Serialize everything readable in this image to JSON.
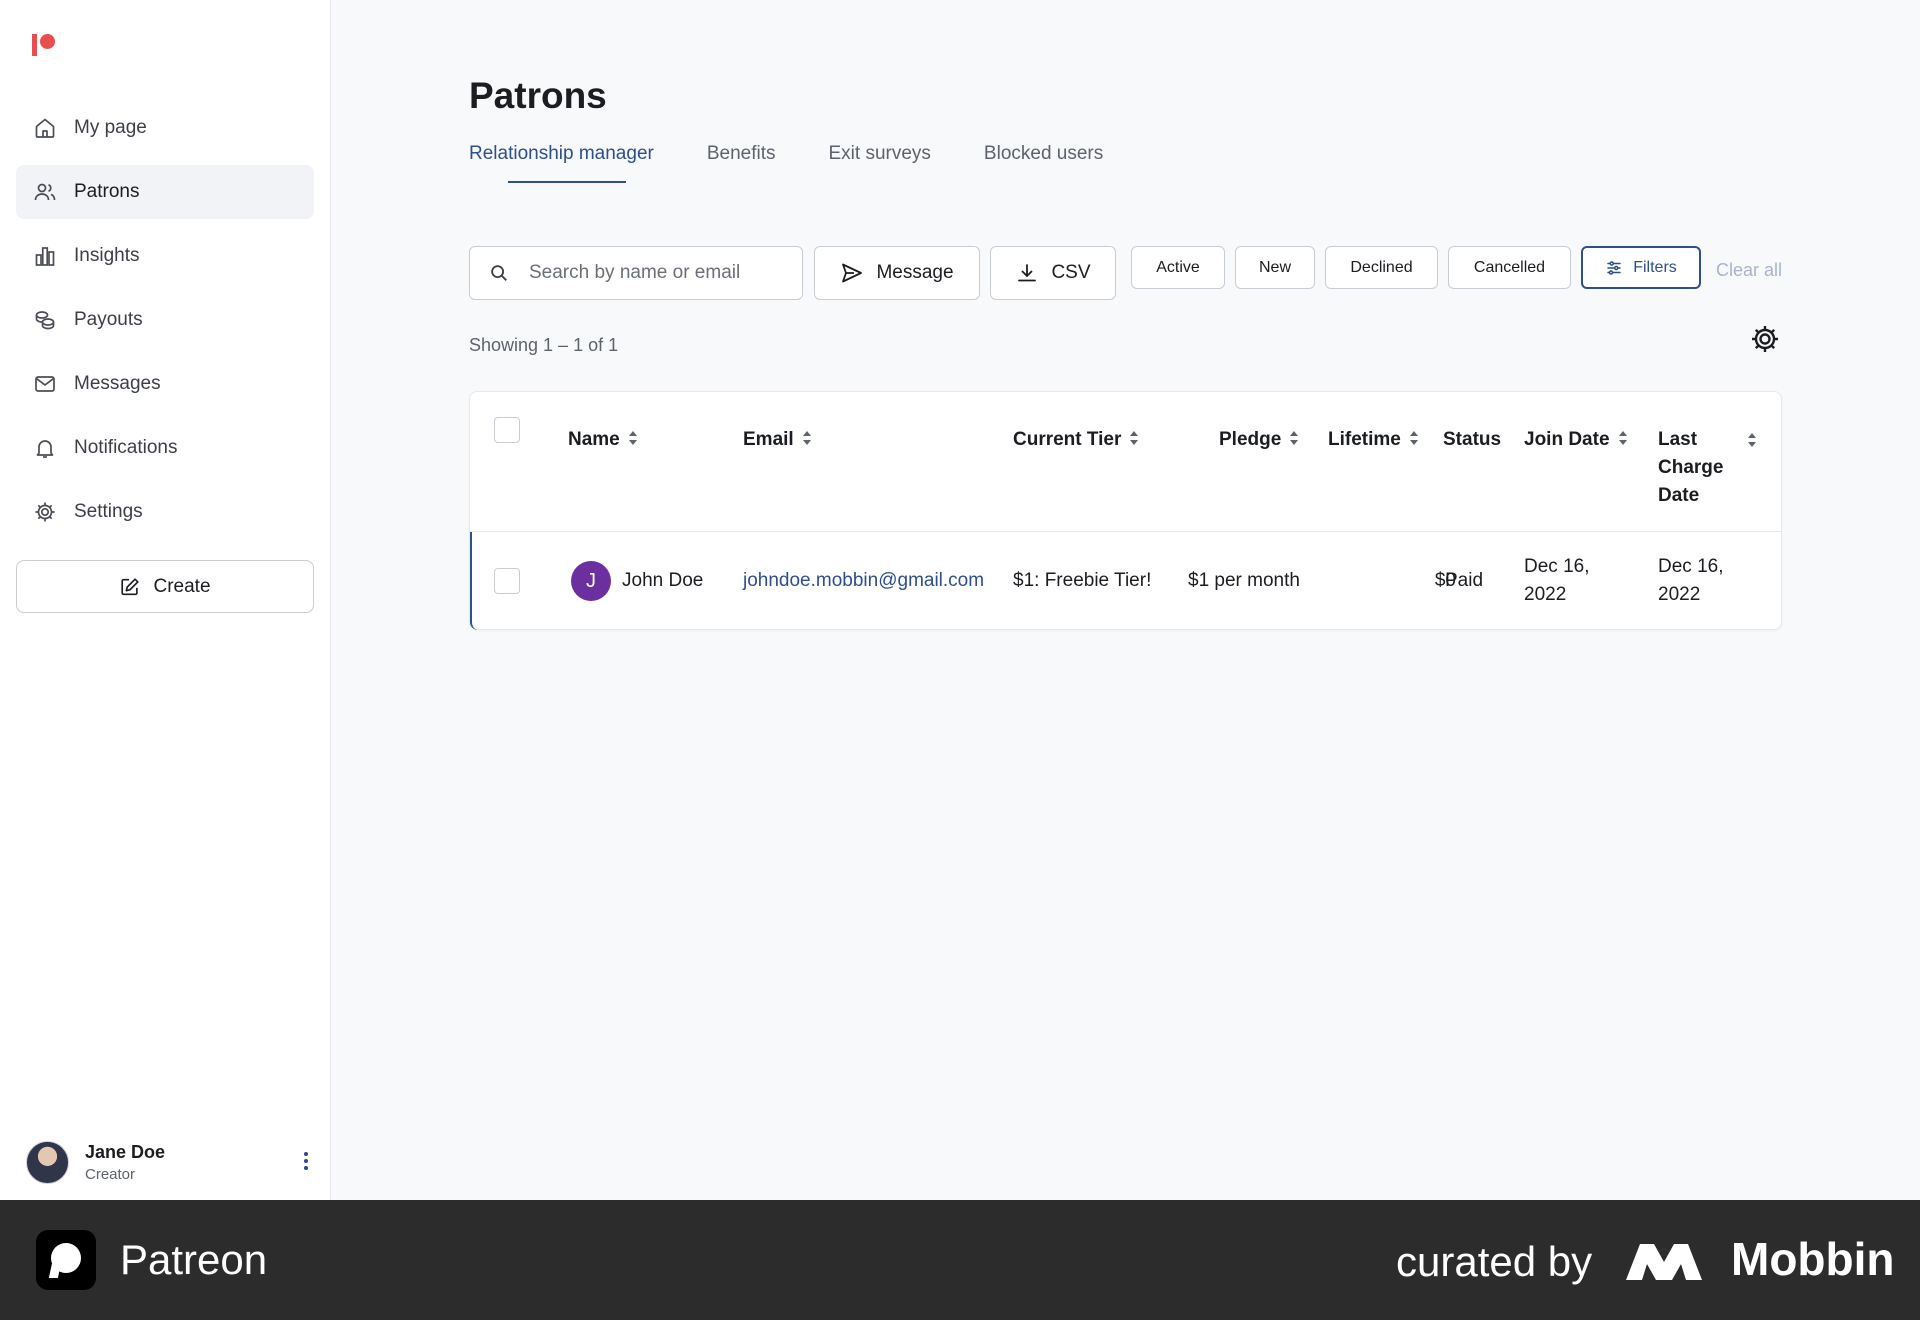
{
  "sidebar": {
    "items": [
      {
        "label": "My page",
        "icon": "home-icon"
      },
      {
        "label": "Patrons",
        "icon": "users-icon",
        "active": true
      },
      {
        "label": "Insights",
        "icon": "bar-chart-icon"
      },
      {
        "label": "Payouts",
        "icon": "coins-icon"
      },
      {
        "label": "Messages",
        "icon": "mail-icon"
      },
      {
        "label": "Notifications",
        "icon": "bell-icon"
      },
      {
        "label": "Settings",
        "icon": "gear-icon"
      }
    ],
    "create_label": "Create",
    "user": {
      "name": "Jane Doe",
      "role": "Creator"
    }
  },
  "page": {
    "title": "Patrons",
    "tabs": [
      {
        "label": "Relationship manager",
        "active": true
      },
      {
        "label": "Benefits"
      },
      {
        "label": "Exit surveys"
      },
      {
        "label": "Blocked users"
      }
    ]
  },
  "toolbar": {
    "search_placeholder": "Search by name or email",
    "message_label": "Message",
    "csv_label": "CSV",
    "chips": [
      "Active",
      "New",
      "Declined",
      "Cancelled"
    ],
    "filters_label": "Filters",
    "clear_all_label": "Clear all"
  },
  "showing_text": "Showing 1 – 1 of 1",
  "table": {
    "columns": [
      "Name",
      "Email",
      "Current Tier",
      "Pledge",
      "Lifetime",
      "Status",
      "Join Date",
      "Last Charge Date"
    ],
    "rows": [
      {
        "avatar_initial": "J",
        "name": "John Doe",
        "email": "johndoe.mobbin@gmail.com",
        "tier": "$1: Freebie Tier!",
        "pledge": "$1 per month",
        "lifetime": "$0",
        "status": "Paid",
        "join_date": "Dec 16, 2022",
        "last_charge_date": "Dec 16, 2022"
      }
    ]
  },
  "footer": {
    "brand": "Patreon",
    "curated_by": "curated by",
    "mobbin": "Mobbin"
  },
  "colors": {
    "accent": "#2d4f8c",
    "brand_red": "#e94e4e",
    "avatar_purple": "#6b2fa0",
    "footer_bg": "#2c2c2c"
  }
}
